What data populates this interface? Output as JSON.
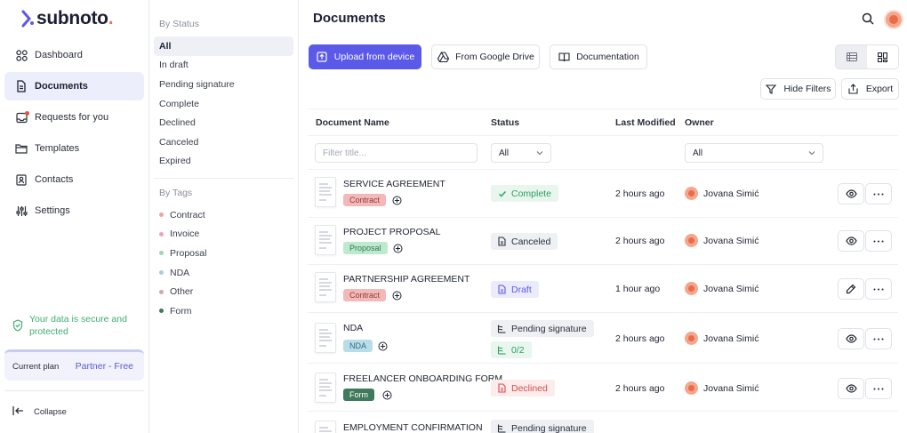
{
  "brand": {
    "name": "subnoto",
    "dot": ".",
    "accent": "#5b59e8"
  },
  "sidebar": {
    "items": [
      {
        "label": "Dashboard",
        "icon": "dashboard-grid-icon"
      },
      {
        "label": "Documents",
        "icon": "document-icon",
        "active": true
      },
      {
        "label": "Requests for you",
        "icon": "inbox-icon",
        "badge": true
      },
      {
        "label": "Templates",
        "icon": "folder-icon"
      },
      {
        "label": "Contacts",
        "icon": "contacts-book-icon"
      },
      {
        "label": "Settings",
        "icon": "sliders-icon"
      }
    ],
    "secure_text": "Your data is secure and protected",
    "plan_label": "Current plan",
    "plan_value": "Partner - Free",
    "collapse_label": "Collapse"
  },
  "filters": {
    "status_heading": "By Status",
    "status_items": [
      "All",
      "In draft",
      "Pending signature",
      "Complete",
      "Declined",
      "Canceled",
      "Expired"
    ],
    "tags_heading": "By Tags",
    "tag_items": [
      {
        "label": "Contract",
        "color": "#f0a3a3"
      },
      {
        "label": "Invoice",
        "color": "#e6a6c4"
      },
      {
        "label": "Proposal",
        "color": "#9ad8b6"
      },
      {
        "label": "NDA",
        "color": "#a8cfdc"
      },
      {
        "label": "Other",
        "color": "#d7a7a7"
      },
      {
        "label": "Form",
        "color": "#3f7a5c"
      }
    ]
  },
  "main": {
    "title": "Documents",
    "upload_label": "Upload from device",
    "drive_label": "From Google Drive",
    "docs_label": "Documentation",
    "hide_filters_label": "Hide Filters",
    "export_label": "Export",
    "columns": {
      "name": "Document Name",
      "status": "Status",
      "modified": "Last Modified",
      "owner": "Owner"
    },
    "filter_title_placeholder": "Filter title...",
    "filter_status_value": "All",
    "filter_owner_value": "All",
    "rows": [
      {
        "name": "SERVICE AGREEMENT",
        "tag": "Contract",
        "status": "Complete",
        "modified": "2 hours ago",
        "owner": "Jovana Simić",
        "action": "eye-icon"
      },
      {
        "name": "PROJECT PROPOSAL",
        "tag": "Proposal",
        "status": "Canceled",
        "modified": "2 hours ago",
        "owner": "Jovana Simić",
        "action": "eye-icon"
      },
      {
        "name": "PARTNERSHIP AGREEMENT",
        "tag": "Contract",
        "status": "Draft",
        "modified": "1 hour ago",
        "owner": "Jovana Simić",
        "action": "pencil-icon"
      },
      {
        "name": "NDA",
        "tag": "NDA",
        "status": "Pending signature",
        "progress": "0/2",
        "modified": "2 hours ago",
        "owner": "Jovana Simić",
        "action": "eye-icon"
      },
      {
        "name": "FREELANCER ONBOARDING FORM",
        "tag": "Form",
        "status": "Declined",
        "modified": "2 hours ago",
        "owner": "Jovana Simić",
        "action": "eye-icon"
      },
      {
        "name": "EMPLOYMENT CONFIRMATION",
        "status": "Pending signature"
      }
    ]
  }
}
